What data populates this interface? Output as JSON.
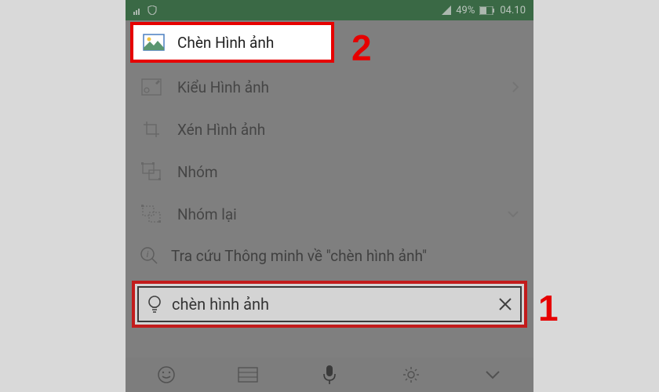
{
  "status": {
    "battery": "49%",
    "time": "04.10"
  },
  "menu": {
    "insert_image": "Chèn Hình ảnh",
    "image_style": "Kiểu Hình ảnh",
    "crop_image": "Xén Hình ảnh",
    "group": "Nhóm",
    "regroup": "Nhóm lại"
  },
  "smart_lookup": "Tra cứu Thông minh về \"chèn hình ảnh\"",
  "search_value": "chèn hình ảnh",
  "annotations": {
    "label1": "1",
    "label2": "2"
  }
}
